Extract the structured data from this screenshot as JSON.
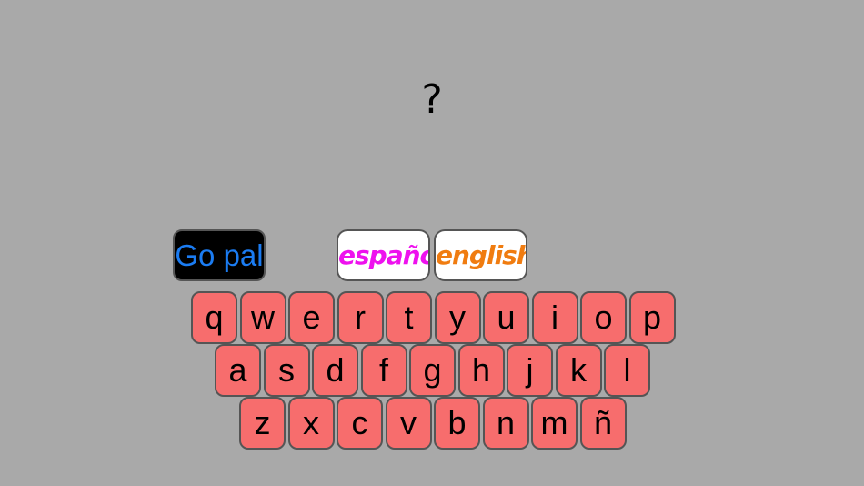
{
  "prompt": {
    "text": "?"
  },
  "go_button": {
    "label": "Go pal"
  },
  "language_buttons": {
    "spanish": {
      "label": "español",
      "color": "#ee11ee"
    },
    "english": {
      "label": "english",
      "color": "#f07c10"
    }
  },
  "keyboard": {
    "key_color": "#f76d6d",
    "rows": [
      [
        "q",
        "w",
        "e",
        "r",
        "t",
        "y",
        "u",
        "i",
        "o",
        "p"
      ],
      [
        "a",
        "s",
        "d",
        "f",
        "g",
        "h",
        "j",
        "k",
        "l"
      ],
      [
        "z",
        "x",
        "c",
        "v",
        "b",
        "n",
        "m",
        "ñ"
      ]
    ]
  }
}
